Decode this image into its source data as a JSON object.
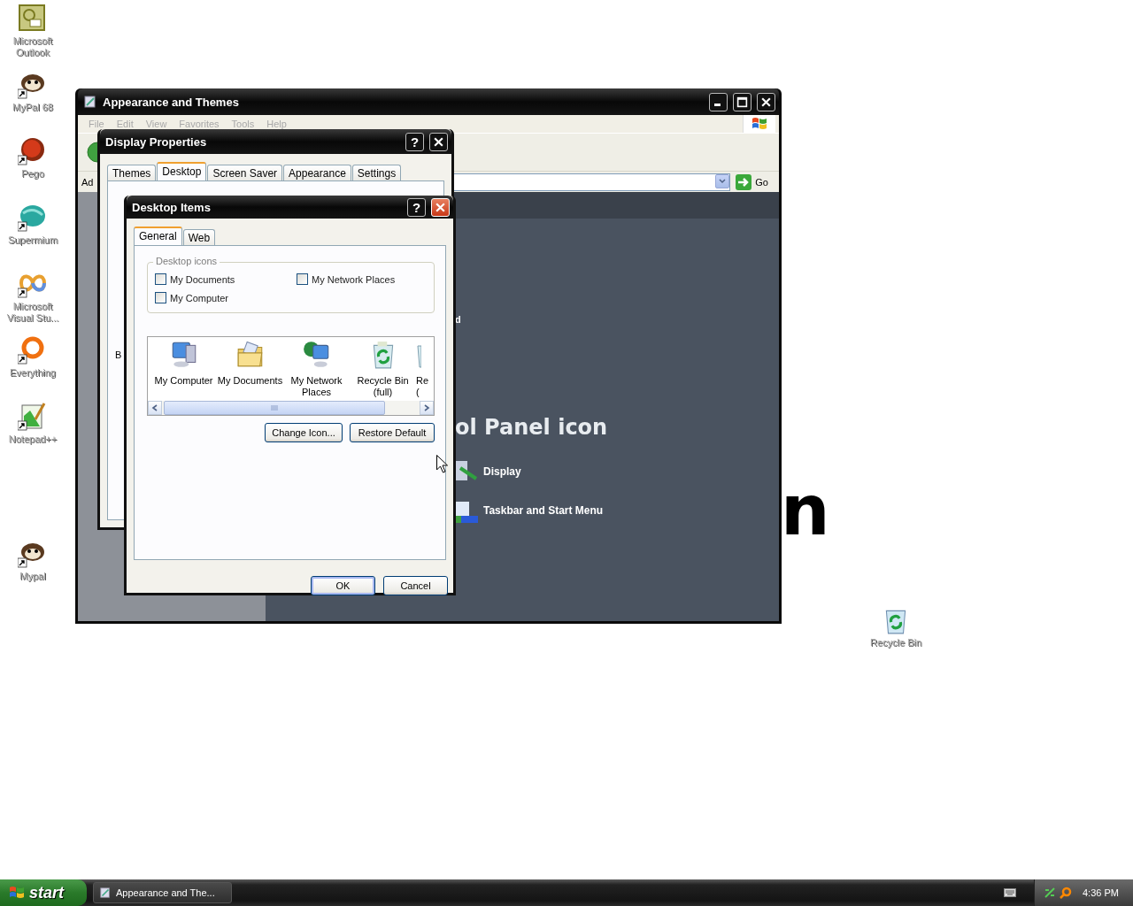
{
  "desktop_icons": [
    {
      "label": "Microsoft Outlook",
      "kind": "outlook",
      "shortcut": false
    },
    {
      "label": "MyPal 68",
      "kind": "mypal",
      "shortcut": true
    },
    {
      "label": "Pego",
      "kind": "pego",
      "shortcut": true
    },
    {
      "label": "Supermium",
      "kind": "supermium",
      "shortcut": true
    },
    {
      "label": "Microsoft Visual Stu...",
      "kind": "visualstudio",
      "shortcut": true
    },
    {
      "label": "Everything",
      "kind": "everything",
      "shortcut": true
    },
    {
      "label": "Notepad++",
      "kind": "notepad",
      "shortcut": true
    },
    {
      "label": "Mypal",
      "kind": "mypal",
      "shortcut": true
    }
  ],
  "recycle_bin": {
    "label": "Recycle Bin"
  },
  "wallpaper_text": "n",
  "explorer_window": {
    "title": "Appearance and Themes",
    "menu": [
      "File",
      "Edit",
      "View",
      "Favorites",
      "Tools",
      "Help"
    ],
    "address_label": "Ad",
    "go_label": "Go",
    "partial_link": "d",
    "heading": "ol Panel icon",
    "tasks": [
      {
        "label": "Display",
        "kind": "display"
      },
      {
        "label": "Taskbar and Start Menu",
        "kind": "taskbar"
      }
    ]
  },
  "display_properties": {
    "title": "Display Properties",
    "help_label": "?",
    "tabs": [
      {
        "label": "Themes",
        "selected": false
      },
      {
        "label": "Desktop",
        "selected": true
      },
      {
        "label": "Screen Saver",
        "selected": false
      },
      {
        "label": "Appearance",
        "selected": false
      },
      {
        "label": "Settings",
        "selected": false
      }
    ],
    "partial_label": "B"
  },
  "desktop_items": {
    "title": "Desktop Items",
    "help_label": "?",
    "tabs": [
      {
        "label": "General",
        "selected": true
      },
      {
        "label": "Web",
        "selected": false
      }
    ],
    "group_title": "Desktop icons",
    "checkboxes": [
      {
        "label": "My Documents",
        "checked": false
      },
      {
        "label": "My Network Places",
        "checked": false
      },
      {
        "label": "My Computer",
        "checked": false
      }
    ],
    "icons": [
      {
        "label": "My Computer",
        "kind": "computer"
      },
      {
        "label": "My Documents",
        "kind": "documents"
      },
      {
        "label": "My Network Places",
        "kind": "network"
      },
      {
        "label": "Recycle Bin (full)",
        "kind": "recycle_full"
      },
      {
        "label": "Re (",
        "kind": "partial"
      }
    ],
    "buttons": [
      "Change Icon...",
      "Restore Default"
    ],
    "dialog_buttons": [
      "OK",
      "Cancel"
    ]
  },
  "taskbar": {
    "start_label": "start",
    "tasks": [
      {
        "label": "Appearance and The...",
        "selected": false
      }
    ],
    "clock": "4:36 PM"
  }
}
